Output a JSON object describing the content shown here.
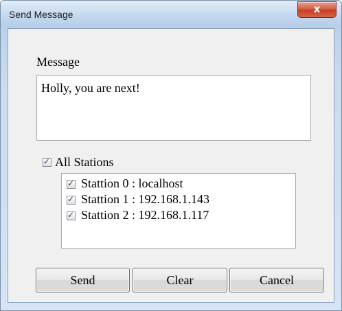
{
  "window": {
    "title": "Send Message",
    "close_label": "x"
  },
  "message": {
    "label": "Message",
    "value": "Holly, you are next!"
  },
  "all_stations": {
    "label": "All Stations",
    "checked": true
  },
  "stations": [
    {
      "label": "Stattion 0 : localhost",
      "checked": true
    },
    {
      "label": "Stattion 1 : 192.168.1.143",
      "checked": true
    },
    {
      "label": "Stattion 2 : 192.168.1.117",
      "checked": true
    }
  ],
  "buttons": {
    "send": "Send",
    "clear": "Clear",
    "cancel": "Cancel"
  }
}
